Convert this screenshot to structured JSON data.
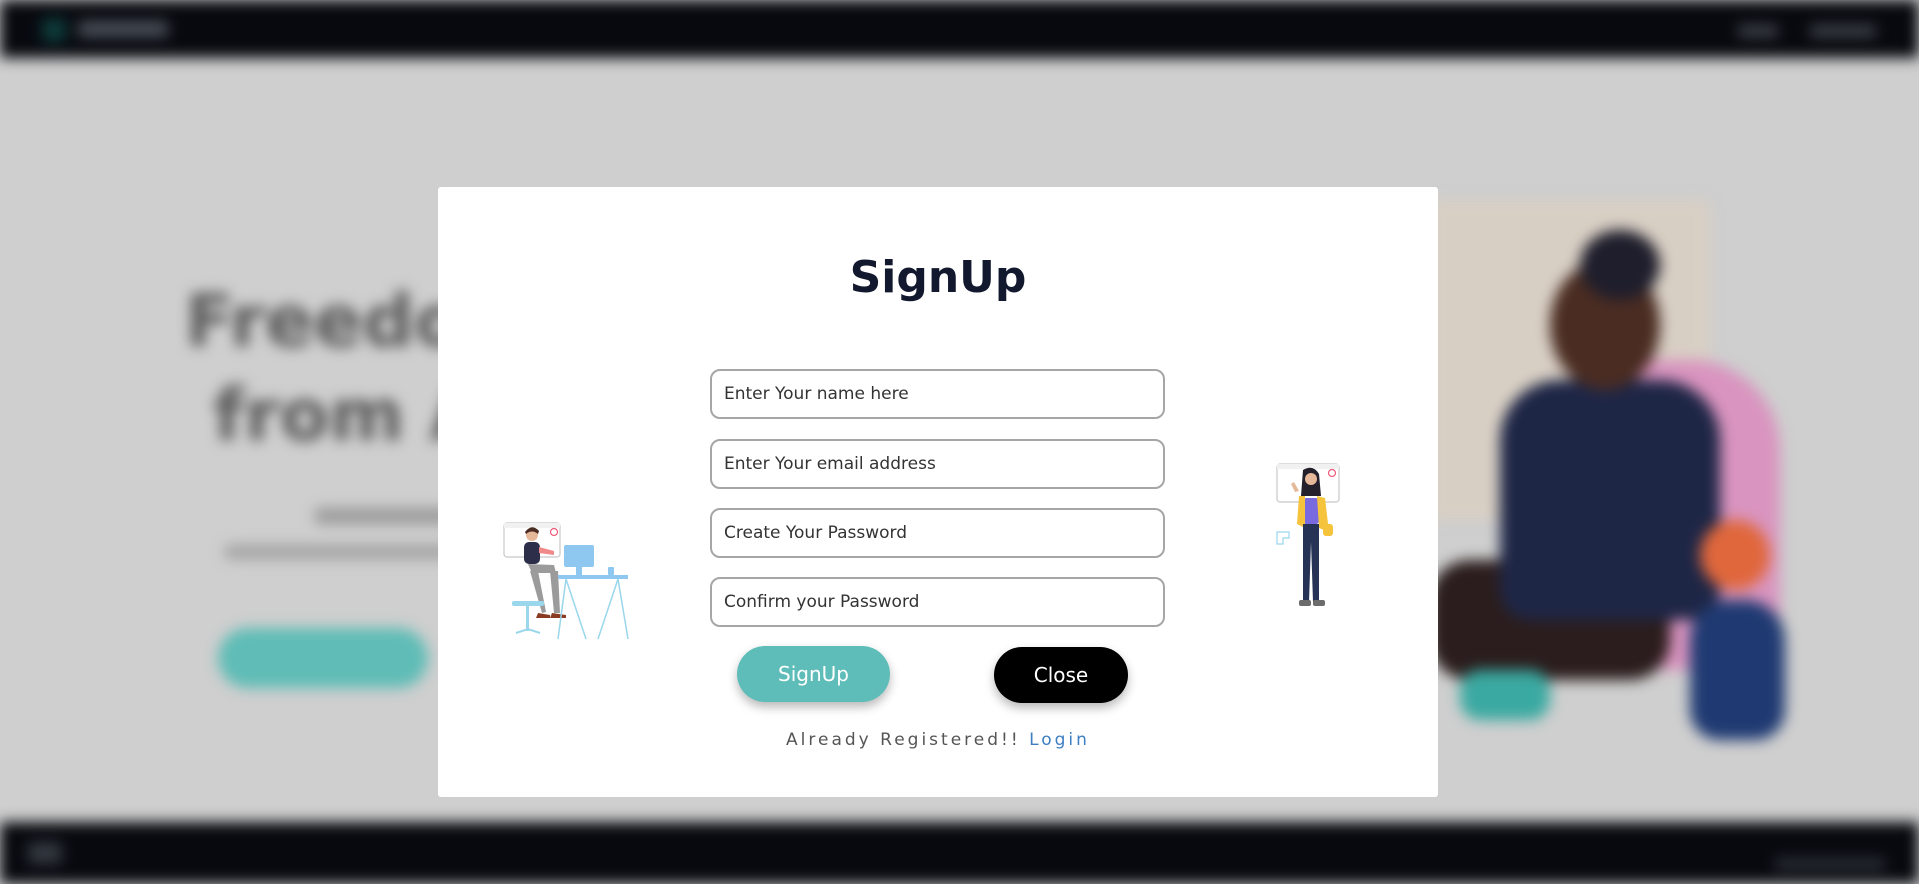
{
  "background": {
    "hero_line1": "Freedo",
    "hero_line2": "from A"
  },
  "modal": {
    "title": "SignUp",
    "fields": {
      "name_placeholder": "Enter Your name here",
      "email_placeholder": "Enter Your email address",
      "password_placeholder": "Create Your Password",
      "confirm_placeholder": "Confirm your Password"
    },
    "signup_label": "SignUp",
    "close_label": "Close",
    "already_text": "Already Registered!!",
    "login_label": "Login"
  },
  "colors": {
    "accent_teal": "#5fbdb9",
    "title_navy": "#12192e",
    "link_blue": "#3d7fc2",
    "overlay_gray": "#cfcfcf",
    "bar_black": "#07090f"
  }
}
